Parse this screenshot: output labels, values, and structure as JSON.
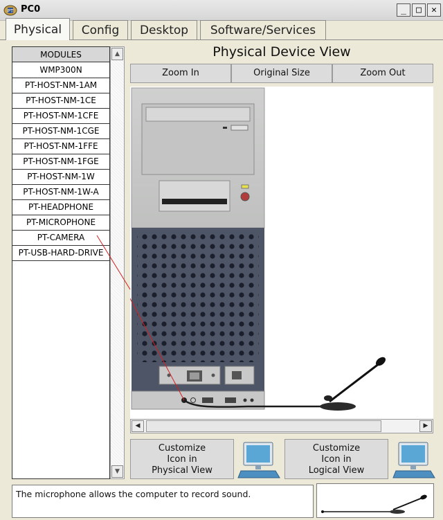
{
  "window": {
    "title": "PC0",
    "minimize_label": "_",
    "maximize_label": "□",
    "close_label": "✕"
  },
  "tabs": [
    {
      "label": "Physical",
      "active": true
    },
    {
      "label": "Config",
      "active": false
    },
    {
      "label": "Desktop",
      "active": false
    },
    {
      "label": "Software/Services",
      "active": false
    }
  ],
  "modules": {
    "header": "MODULES",
    "items": [
      "WMP300N",
      "PT-HOST-NM-1AM",
      "PT-HOST-NM-1CE",
      "PT-HOST-NM-1CFE",
      "PT-HOST-NM-1CGE",
      "PT-HOST-NM-1FFE",
      "PT-HOST-NM-1FGE",
      "PT-HOST-NM-1W",
      "PT-HOST-NM-1W-A",
      "PT-HEADPHONE",
      "PT-MICROPHONE",
      "PT-CAMERA",
      "PT-USB-HARD-DRIVE"
    ]
  },
  "device_view": {
    "title": "Physical Device View",
    "zoom_in": "Zoom In",
    "original_size": "Original Size",
    "zoom_out": "Zoom Out"
  },
  "customize": {
    "physical": {
      "line1": "Customize",
      "line2": "Icon in",
      "line3": "Physical View"
    },
    "logical": {
      "line1": "Customize",
      "line2": "Icon in",
      "line3": "Logical View"
    }
  },
  "description": "The microphone allows the computer to record sound.",
  "icons": {
    "app": "packet-tracer-icon",
    "pc": "pc-monitor-icon",
    "microphone": "microphone-icon"
  },
  "colors": {
    "window_bg": "#ece9d8",
    "tower": "#c8c9c8",
    "tower_back": "#4e5567",
    "monitor_blue": "#5aa7d6"
  }
}
